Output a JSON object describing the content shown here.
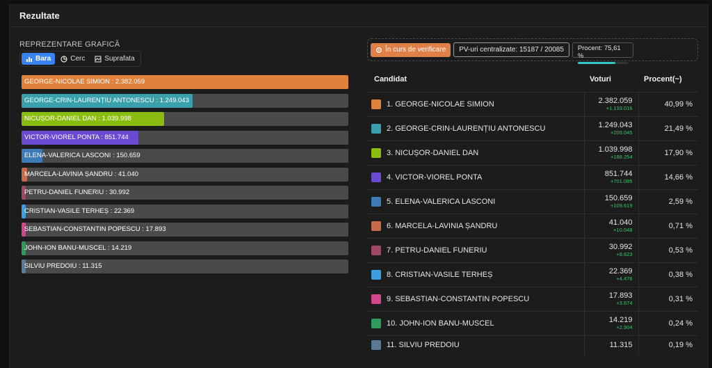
{
  "header": {
    "title": "Rezultate"
  },
  "chart_toggle": {
    "title": "REPREZENTARE GRAFICĂ",
    "options": [
      {
        "label": "Bara",
        "icon": "bar-chart-icon",
        "active": true
      },
      {
        "label": "Cerc",
        "icon": "pie-chart-icon",
        "active": false
      },
      {
        "label": "Suprafata",
        "icon": "area-chart-icon",
        "active": false
      }
    ]
  },
  "status": {
    "verify_label": "În curs de verificare",
    "pv_label": "PV-uri centralizate: 15187 / 20085",
    "procent_label": "Procent: 75,61 %",
    "procent_value": 75.61
  },
  "table": {
    "headers": {
      "candidat": "Candidat",
      "voturi": "Voturi",
      "procent": "Procent(~)"
    }
  },
  "candidates": [
    {
      "label": "GEORGE-NICOLAE SIMION : 2.382.059",
      "row": "1. GEORGE-NICOLAE SIMION",
      "votes": "2.382.059",
      "delta": "+1.133.016",
      "pct": "40,99 %",
      "pct_value": 40.99,
      "color": "#e0823c"
    },
    {
      "label": "GEORGE-CRIN-LAURENȚIU ANTONESCU : 1.249.043",
      "row": "2. GEORGE-CRIN-LAURENȚIU ANTONESCU",
      "votes": "1.249.043",
      "delta": "+209.045",
      "pct": "21,49 %",
      "pct_value": 21.49,
      "color": "#3aa0ac"
    },
    {
      "label": "NICUȘOR-DANIEL DAN : 1.039.998",
      "row": "3. NICUȘOR-DANIEL DAN",
      "votes": "1.039.998",
      "delta": "+188.254",
      "pct": "17,90 %",
      "pct_value": 17.9,
      "color": "#8bbd10"
    },
    {
      "label": "VICTOR-VIOREL PONTA : 851.744",
      "row": "4. VICTOR-VIOREL PONTA",
      "votes": "851.744",
      "delta": "+701.085",
      "pct": "14,66 %",
      "pct_value": 14.66,
      "color": "#6a4ad0"
    },
    {
      "label": "ELENA-VALERICA LASCONI : 150.659",
      "row": "5. ELENA-VALERICA LASCONI",
      "votes": "150.659",
      "delta": "+109.619",
      "pct": "2,59 %",
      "pct_value": 2.59,
      "color": "#3d7ab8"
    },
    {
      "label": "MARCELA-LAVINIA ȘANDRU : 41.040",
      "row": "6. MARCELA-LAVINIA ȘANDRU",
      "votes": "41.040",
      "delta": "+10.048",
      "pct": "0,71 %",
      "pct_value": 0.71,
      "color": "#c96a4a"
    },
    {
      "label": "PETRU-DANIEL FUNERIU : 30.992",
      "row": "7. PETRU-DANIEL FUNERIU",
      "votes": "30.992",
      "delta": "+8.623",
      "pct": "0,53 %",
      "pct_value": 0.53,
      "color": "#a0486a"
    },
    {
      "label": "CRISTIAN-VASILE TERHEȘ : 22.369",
      "row": "8. CRISTIAN-VASILE TERHEȘ",
      "votes": "22.369",
      "delta": "+4.476",
      "pct": "0,38 %",
      "pct_value": 0.38,
      "color": "#3a9ee0"
    },
    {
      "label": "SEBASTIAN-CONSTANTIN POPESCU : 17.893",
      "row": "9. SEBASTIAN-CONSTANTIN POPESCU",
      "votes": "17.893",
      "delta": "+3.674",
      "pct": "0,31 %",
      "pct_value": 0.31,
      "color": "#d0488a"
    },
    {
      "label": "JOHN-ION BANU-MUSCEL : 14.219",
      "row": "10. JOHN-ION BANU-MUSCEL",
      "votes": "14.219",
      "delta": "+2.904",
      "pct": "0,24 %",
      "pct_value": 0.24,
      "color": "#2f9a5c"
    },
    {
      "label": "SILVIU PREDOIU : 11.315",
      "row": "11. SILVIU PREDOIU",
      "votes": "11.315",
      "delta": "",
      "pct": "0,19 %",
      "pct_value": 0.19,
      "color": "#5a7a96"
    }
  ],
  "chart_data": {
    "type": "bar",
    "orientation": "horizontal",
    "categories": [
      "GEORGE-NICOLAE SIMION",
      "GEORGE-CRIN-LAURENȚIU ANTONESCU",
      "NICUȘOR-DANIEL DAN",
      "VICTOR-VIOREL PONTA",
      "ELENA-VALERICA LASCONI",
      "MARCELA-LAVINIA ȘANDRU",
      "PETRU-DANIEL FUNERIU",
      "CRISTIAN-VASILE TERHEȘ",
      "SEBASTIAN-CONSTANTIN POPESCU",
      "JOHN-ION BANU-MUSCEL",
      "SILVIU PREDOIU"
    ],
    "values": [
      2382059,
      1249043,
      1039998,
      851744,
      150659,
      41040,
      30992,
      22369,
      17893,
      14219,
      11315
    ],
    "xlim": [
      0,
      2382059
    ]
  }
}
